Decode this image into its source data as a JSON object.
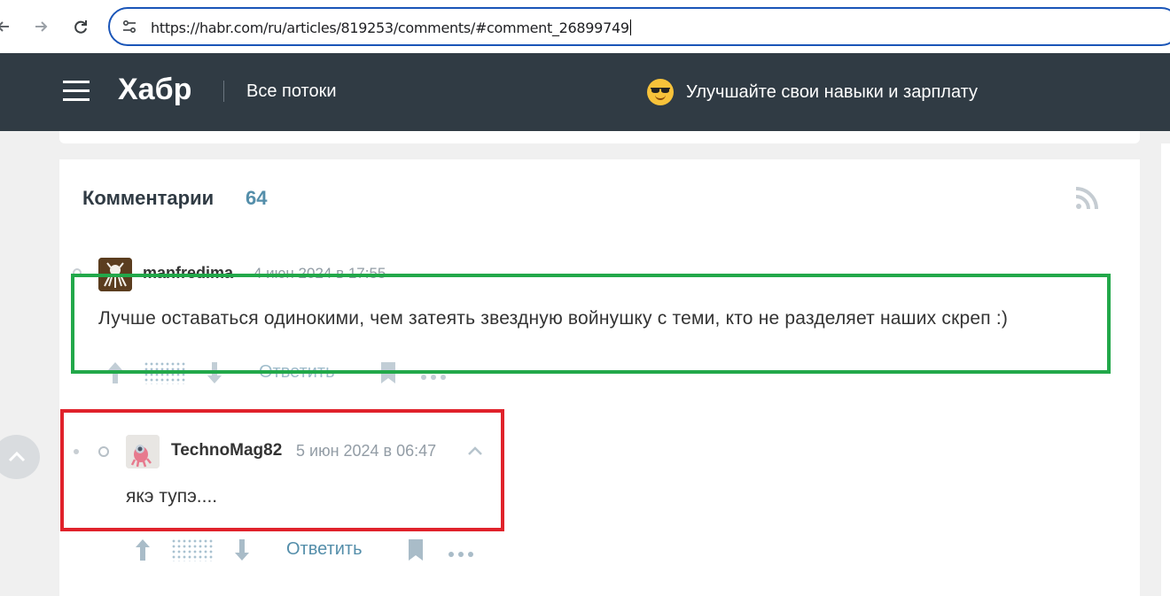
{
  "browser": {
    "url": "https://habr.com/ru/articles/819253/comments/#comment_26899749",
    "icons": {
      "back": "back-arrow-icon",
      "forward": "forward-arrow-icon",
      "reload": "reload-icon",
      "site_info": "tune-icon"
    }
  },
  "header": {
    "logo": "Хабр",
    "nav_label": "Все потоки",
    "promo_text": "Улучшайте свои навыки и зарплату",
    "background_color": "#303b44"
  },
  "comments": {
    "title": "Комментарии",
    "count": "64",
    "items": [
      {
        "author": "manfredima",
        "date": "4 июн 2024 в 17:55",
        "text": "Лучше оставаться одинокими, чем затеять звездную войнушку с теми, кто не разделяет наших скреп :)",
        "reply_label": "Ответить"
      },
      {
        "author": "TechnoMag82",
        "date": "5 июн 2024 в 06:47",
        "text": "якэ тупэ....",
        "reply_label": "Ответить"
      }
    ]
  },
  "colors": {
    "accent": "#548eaa",
    "highlight_green": "#22a84a",
    "highlight_red": "#e0222b"
  }
}
